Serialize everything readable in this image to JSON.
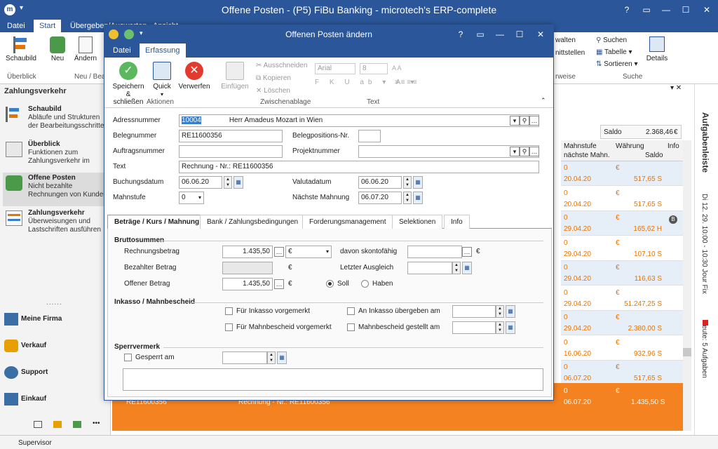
{
  "app": {
    "title": "Offene Posten - (P5) FiBu Banking - microtech's ERP-complete",
    "tabs": [
      "Datei",
      "Start",
      "Übergeben/Auswerten",
      "Ansicht"
    ],
    "ribbon": {
      "schaubild": "Schaubild",
      "neu": "Neu",
      "aendern": "Ändern",
      "group_ueberblick": "Überblick",
      "group_neu": "Neu / Bea",
      "verwalten": "walten",
      "schnittstellen": "nittstellen",
      "suchen": "Suchen",
      "tabelle": "Tabelle",
      "sortieren": "Sortieren",
      "details": "Details",
      "group_suche": "Suche",
      "group_weise": "rweise"
    }
  },
  "nav": {
    "header": "Zahlungsverkehr",
    "items": [
      {
        "title": "Schaubild",
        "desc": "Abläufe und Strukturen der Bearbeitungsschritte"
      },
      {
        "title": "Überblick",
        "desc": "Funktionen zum Zahlungsverkehr im"
      },
      {
        "title": "Offene Posten",
        "desc": "Nicht bezahlte Rechnungen von Kunden"
      },
      {
        "title": "Zahlungsverkehr",
        "desc": "Überweisungen und Lastschriften ausführen"
      }
    ],
    "dots": "......",
    "big": [
      "Meine Firma",
      "Verkauf",
      "Support",
      "Einkauf"
    ],
    "more": "•••"
  },
  "status": {
    "user": "Supervisor"
  },
  "grid": {
    "saldo_label": "Saldo",
    "saldo_value": "2.368,46",
    "saldo_currency": "€",
    "headers": {
      "mahnstufe": "Mahnstufe",
      "naechste": "nächste Mahn.",
      "waehrung": "Währung",
      "saldo": "Saldo",
      "info": "Info"
    },
    "rows": [
      {
        "stufe": "0",
        "date": "20.04.20",
        "cur": "€",
        "saldo": "517,65 S",
        "info": ""
      },
      {
        "stufe": "0",
        "date": "20.04.20",
        "cur": "€",
        "saldo": "517,65 S",
        "info": ""
      },
      {
        "stufe": "0",
        "date": "29.04.20",
        "cur": "€",
        "saldo": "165,62 H",
        "info": "B"
      },
      {
        "stufe": "0",
        "date": "29.04.20",
        "cur": "€",
        "saldo": "107,10 S",
        "info": ""
      },
      {
        "stufe": "0",
        "date": "29.04.20",
        "cur": "€",
        "saldo": "116,63 S",
        "info": ""
      },
      {
        "stufe": "0",
        "date": "29.04.20",
        "cur": "€",
        "saldo": "51.247,25 S",
        "info": ""
      },
      {
        "stufe": "0",
        "date": "29.04.20",
        "cur": "€",
        "saldo": "2.380,00 S",
        "info": ""
      },
      {
        "stufe": "0",
        "date": "16.06.20",
        "cur": "€",
        "saldo": "932,96 S",
        "info": ""
      },
      {
        "stufe": "0",
        "date": "06.07.20",
        "cur": "€",
        "saldo": "517,65 S",
        "info": ""
      }
    ],
    "selected": {
      "beleg": "RE11600356",
      "text": "Rechnung - Nr.: RE11600356",
      "stufe": "0",
      "date": "06.07.20",
      "cur": "€",
      "saldo": "1.435,50 S"
    }
  },
  "rightbar": {
    "aufgabenleiste": "Aufgabenleiste",
    "termin": "Di 12. 29. 10:00 - 10:30 Jour Fix",
    "heute": "Heute: 5 Aufgaben"
  },
  "dialog": {
    "title": "Offenen Posten ändern",
    "tabs": [
      "Datei",
      "Erfassung"
    ],
    "ribbon": {
      "speichern": "Speichern & schließen",
      "quick": "Quick",
      "verwerfen": "Verwerfen",
      "einfuegen": "Einfügen",
      "ausschneiden": "Ausschneiden",
      "kopieren": "Kopieren",
      "loeschen": "Löschen",
      "font": "Arial",
      "size": "8",
      "group_aktionen": "Aktionen",
      "group_zwischenablage": "Zwischenablage",
      "group_text": "Text"
    },
    "form": {
      "adressnummer_label": "Adressnummer",
      "adressnummer": "10004",
      "adress_name": "Herr Amadeus Mozart in Wien",
      "belegnummer_label": "Belegnummer",
      "belegnummer": "RE11600356",
      "belegpos_label": "Belegpositions-Nr.",
      "auftragsnummer_label": "Auftragsnummer",
      "projektnummer_label": "Projektnummer",
      "text_label": "Text",
      "text": "Rechnung - Nr.: RE11600356",
      "buchungsdatum_label": "Buchungsdatum",
      "buchungsdatum": "06.06.20",
      "valutadatum_label": "Valutadatum",
      "valutadatum": "06.06.20",
      "mahnstufe_label": "Mahnstufe",
      "mahnstufe": "0",
      "naechste_label": "Nächste Mahnung",
      "naechste": "06.07.20"
    },
    "subtabs": [
      "Beträge / Kurs / Mahnung",
      "Bank / Zahlungsbedingungen",
      "Forderungsmanagement",
      "Selektionen",
      "Info"
    ],
    "betraege": {
      "brutto": "Bruttosummen",
      "rechnungsbetrag_label": "Rechnungsbetrag",
      "rechnungsbetrag": "1.435,50",
      "currency": "€",
      "skonto_label": "davon skontofähig",
      "bezahlt_label": "Bezahlter Betrag",
      "ausgleich_label": "Letzter Ausgleich",
      "offen_label": "Offener Betrag",
      "offen": "1.435,50",
      "soll": "Soll",
      "haben": "Haben",
      "inkasso": "Inkasso / Mahnbescheid",
      "fuer_inkasso": "Für Inkasso vorgemerkt",
      "an_inkasso": "An Inkasso übergeben am",
      "fuer_mahn": "Für Mahnbescheid vorgemerkt",
      "mahn_gestellt": "Mahnbescheid gestellt am",
      "sperr": "Sperrvermerk",
      "gesperrt": "Gesperrt am"
    }
  }
}
